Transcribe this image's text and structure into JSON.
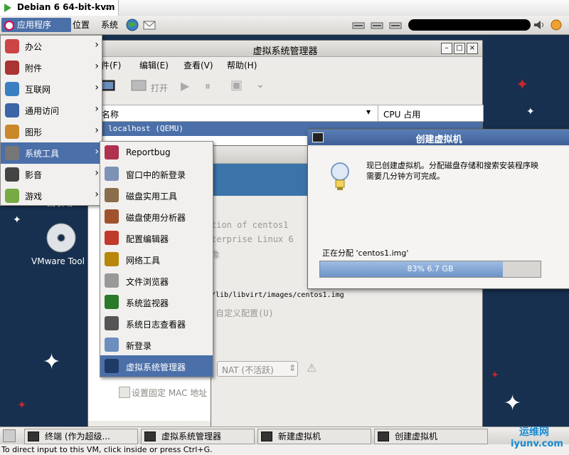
{
  "vmware": {
    "tab_title": "Debian 6 64-bit-kvm",
    "close_glyph": "×"
  },
  "panel": {
    "apps_label": "应用程序",
    "places_label": "位置",
    "system_label": "系统"
  },
  "apps_menu": [
    {
      "label": "办公",
      "icon": "office-icon"
    },
    {
      "label": "附件",
      "icon": "accessories-icon"
    },
    {
      "label": "互联网",
      "icon": "internet-icon"
    },
    {
      "label": "通用访问",
      "icon": "accessibility-icon"
    },
    {
      "label": "图形",
      "icon": "graphics-icon"
    },
    {
      "label": "系统工具",
      "icon": "system-tools-icon"
    },
    {
      "label": "影音",
      "icon": "multimedia-icon"
    },
    {
      "label": "游戏",
      "icon": "games-icon"
    }
  ],
  "system_tools": [
    {
      "label": "Reportbug"
    },
    {
      "label": "窗口中的新登录"
    },
    {
      "label": "磁盘实用工具"
    },
    {
      "label": "磁盘使用分析器"
    },
    {
      "label": "配置编辑器"
    },
    {
      "label": "网络工具"
    },
    {
      "label": "文件浏览器"
    },
    {
      "label": "系统监视器"
    },
    {
      "label": "系统日志查看器"
    },
    {
      "label": "新登录"
    },
    {
      "label": "虚拟系统管理器"
    }
  ],
  "vmm": {
    "title": "虚拟系统管理器",
    "menu": {
      "file": "件(F)",
      "edit": "编辑(E)",
      "view": "查看(V)",
      "help": "帮助(H)"
    },
    "toolbar_open": "打开",
    "col_name": "名称",
    "col_cpu": "CPU 占用",
    "host_row": "localhost (QEMU)"
  },
  "newvm": {
    "title": "新建虚拟机",
    "line1": "tion of centos1",
    "line2": "terprise Linux 6",
    "line3": "像",
    "path": "/lib/libvirt/images/centos1.img",
    "custom": "自定义配置(U)",
    "nat": "NAT (不活跃)",
    "mac": "设置固定 MAC 地址"
  },
  "create": {
    "title": "创建虚拟机",
    "message1": "现已创建虚拟机。分配磁盘存储和搜索安装程序映",
    "message2": "需要几分钟方可完成。",
    "allocating": "正在分配 'centos1.img'",
    "progress_text": "83% 6.7 GB",
    "progress_fraction": 0.83
  },
  "desktop": {
    "icon_label": "VMware Tool",
    "partial_label": "回收站"
  },
  "taskbar": [
    {
      "label": "终端 (作为超级...",
      "icon": "terminal-icon"
    },
    {
      "label": "虚拟系统管理器",
      "icon": "vmm-icon"
    },
    {
      "label": "新建虚拟机",
      "icon": "new-vm-icon"
    },
    {
      "label": "创建虚拟机",
      "icon": "create-vm-icon"
    }
  ],
  "statusbar": {
    "text": "To direct input to this VM, click inside or press Ctrl+G."
  },
  "watermark": {
    "line1": "运维网",
    "line2": "iyunv.com"
  },
  "colors": {
    "menu_select": "#4b6fa8",
    "desktop": "#17304f",
    "progress": "#6d93c8"
  }
}
